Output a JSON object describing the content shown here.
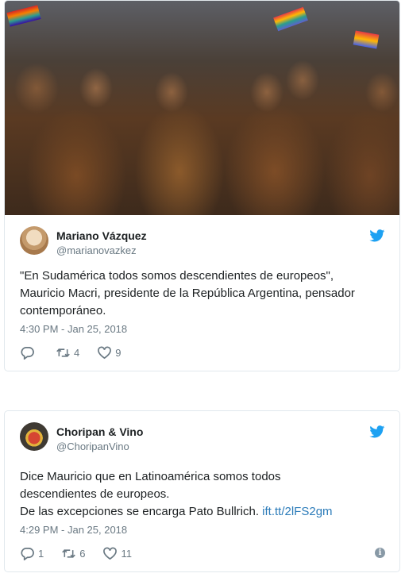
{
  "tweets": [
    {
      "name": "Mariano Vázquez",
      "handle": "@marianovazkez",
      "text_lines": [
        "\"En Sudamérica todos somos descendientes de europeos\",",
        "Mauricio Macri, presidente de la República Argentina, pensador",
        "contemporáneo."
      ],
      "time": "4:30 PM - Jan 25, 2018",
      "replies": "",
      "retweets": "4",
      "likes": "9",
      "has_photo": true
    },
    {
      "name": "Choripan & Vino",
      "handle": "@ChoripanVino",
      "text_lines": [
        "Dice Mauricio que en Latinoamérica somos todos",
        "descendientes de europeos.",
        "De las excepciones se encarga Pato Bullrich."
      ],
      "link": "ift.tt/2lFS2gm",
      "time": "4:29 PM - Jan 25, 2018",
      "replies": "1",
      "retweets": "6",
      "likes": "11",
      "info_icon": "i"
    }
  ],
  "icons": {
    "brand": "twitter-bird-icon",
    "reply": "reply-icon",
    "retweet": "retweet-icon",
    "like": "heart-icon",
    "info": "info-icon"
  },
  "colors": {
    "twitter_blue": "#1da1f2",
    "link": "#2b7bb9",
    "secondary_text": "#697882",
    "border": "#e1e8ed"
  }
}
